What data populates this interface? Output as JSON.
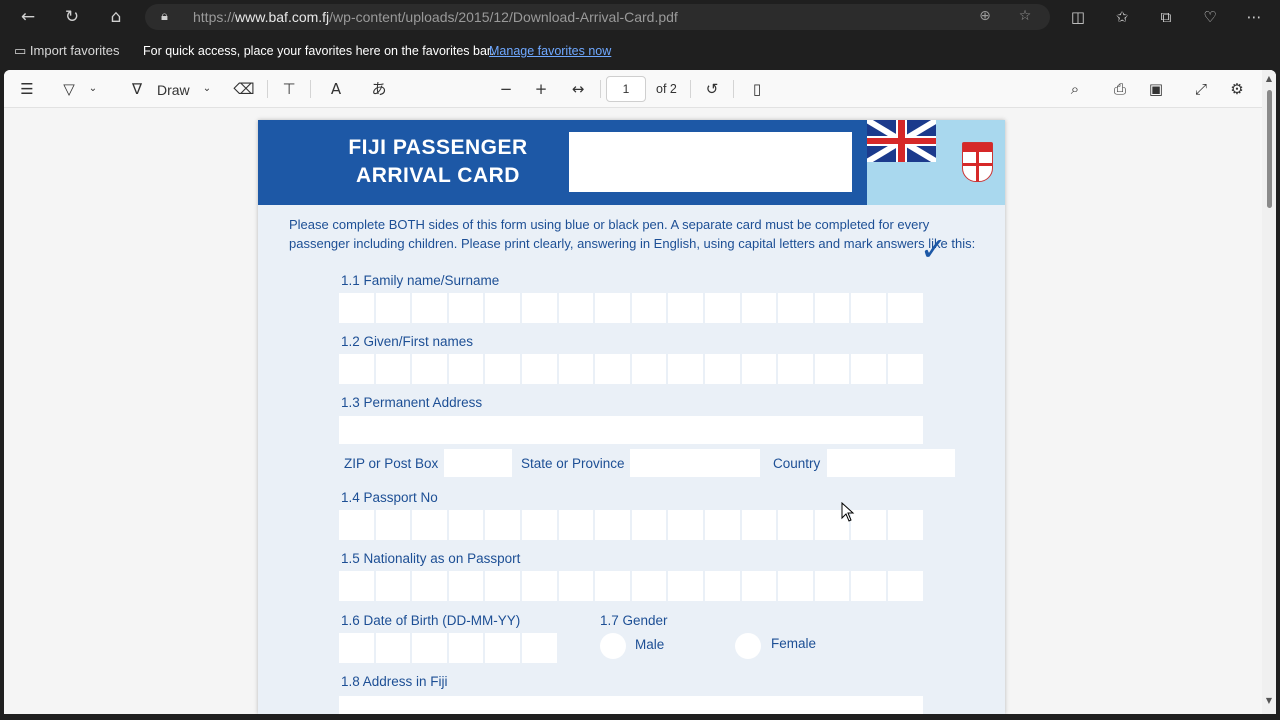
{
  "browser": {
    "url_scheme": "https://",
    "url_host": "www.baf.com.fj",
    "url_path": "/wp-content/uploads/2015/12/Download-Arrival-Card.pdf",
    "icons": [
      "back-icon",
      "refresh-icon",
      "home-icon",
      "lock-icon",
      "zoom-icon",
      "favorite-star-icon",
      "split-screen-icon",
      "favorites-icon",
      "collections-icon",
      "health-icon",
      "more-icon"
    ]
  },
  "favorites_bar": {
    "import_label": "Import favorites",
    "message": "For quick access, place your favorites here on the favorites bar.",
    "link": "Manage favorites now"
  },
  "pdf_toolbar": {
    "draw_label": "Draw",
    "current_page": "1",
    "page_count": "of 2"
  },
  "form": {
    "title_line1": "FIJI PASSENGER",
    "title_line2": "ARRIVAL CARD",
    "instructions": "Please complete BOTH sides of this form using blue or black pen. A separate card must be completed for every passenger including children. Please print clearly, answering in English, using capital letters and mark answers like this:",
    "tick": "✓",
    "fields": {
      "family_name": "1.1  Family name/Surname",
      "given_names": "1.2  Given/First names",
      "address": "1.3  Permanent Address",
      "zip": "ZIP or Post Box",
      "state": "State or Province",
      "country": "Country",
      "passport": "1.4  Passport No",
      "nationality": "1.5  Nationality as on Passport",
      "dob": "1.6  Date of Birth (DD-MM-YY)",
      "gender": "1.7  Gender",
      "male": "Male",
      "female": "Female",
      "fiji_address": "1.8  Address in Fiji"
    }
  },
  "colors": {
    "banner_blue": "#1d58a6",
    "label_blue": "#1d4f95",
    "form_background": "#eaf0f7",
    "flag_light_blue": "#a9d8ee"
  }
}
